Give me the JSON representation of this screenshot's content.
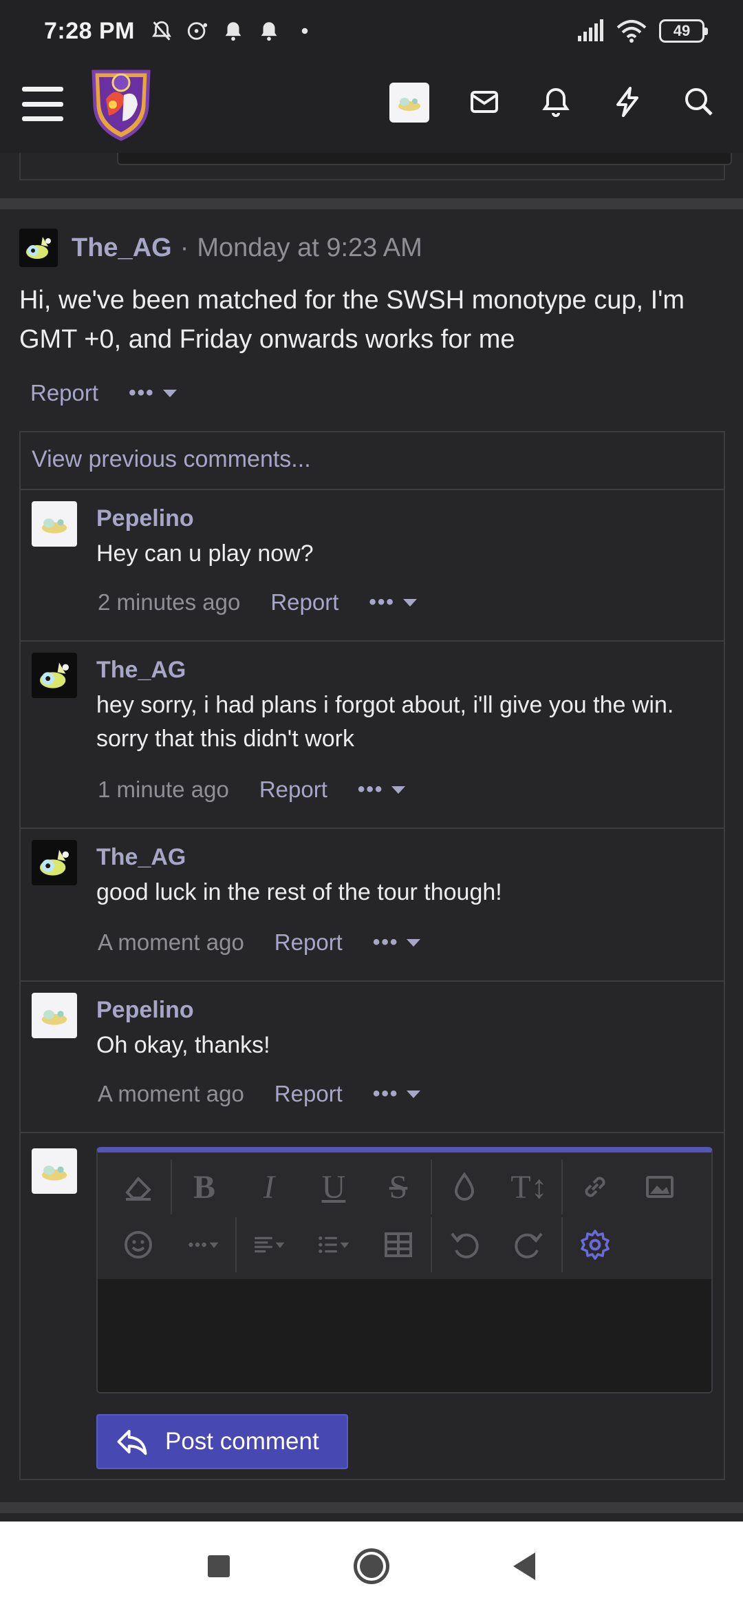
{
  "status_bar": {
    "time": "7:28 PM",
    "battery": "49",
    "icons": [
      "dnd-off-icon",
      "chat-bubble-icon",
      "bell-icon",
      "bell-icon",
      "dot-icon",
      "signal-icon",
      "wifi-icon",
      "battery-icon"
    ]
  },
  "header": {
    "icons": [
      "menu-icon",
      "site-logo",
      "user-avatar",
      "mail-icon",
      "bell-icon",
      "lightning-icon",
      "search-icon"
    ]
  },
  "post": {
    "author": "The_AG",
    "separator": "·",
    "date": "Monday at 9:23 AM",
    "body": "Hi, we've been matched for the SWSH monotype cup, I'm GMT +0, and Friday onwards works for me",
    "report_label": "Report",
    "more_label": "•••"
  },
  "comments": {
    "view_previous": "View previous comments...",
    "items": [
      {
        "author": "Pepelino",
        "text": "Hey can u play now?",
        "time": "2 minutes ago",
        "report": "Report",
        "more": "•••",
        "avatar": "light"
      },
      {
        "author": "The_AG",
        "text": "hey sorry, i had plans i forgot about, i'll give you the win. sorry that this didn't work",
        "time": "1 minute ago",
        "report": "Report",
        "more": "•••",
        "avatar": "dark"
      },
      {
        "author": "The_AG",
        "text": "good luck in the rest of the tour though!",
        "time": "A moment ago",
        "report": "Report",
        "more": "•••",
        "avatar": "dark"
      },
      {
        "author": "Pepelino",
        "text": "Oh okay, thanks!",
        "time": "A moment ago",
        "report": "Report",
        "more": "•••",
        "avatar": "light"
      }
    ]
  },
  "editor": {
    "toolbar_row1": [
      "eraser-icon",
      "bold-icon",
      "italic-icon",
      "underline-icon",
      "strikethrough-icon",
      "color-drop-icon",
      "text-size-icon",
      "link-icon",
      "image-icon"
    ],
    "toolbar_row2": [
      "emoji-icon",
      "more-dropdown-icon",
      "align-icon",
      "list-icon",
      "table-icon",
      "undo-icon",
      "redo-icon",
      "settings-icon"
    ],
    "bold": "B",
    "italic": "I",
    "underline": "U",
    "strike": "S",
    "textsize": "T↕",
    "post_button": "Post comment"
  },
  "colors": {
    "background": "#262628",
    "accent": "#4848b3",
    "username": "#a7a6c7",
    "muted": "#8f8f95"
  }
}
